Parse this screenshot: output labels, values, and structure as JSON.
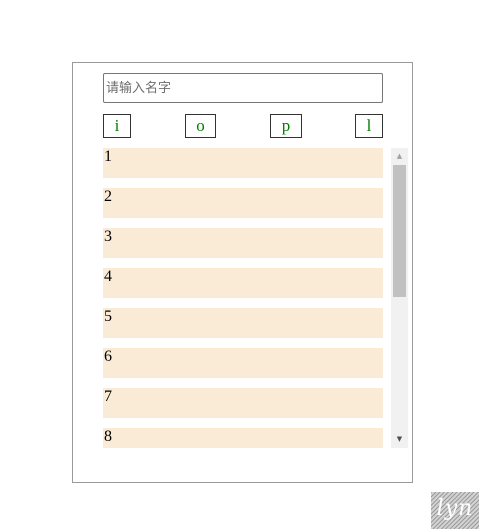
{
  "search": {
    "placeholder": "请输入名字",
    "value": ""
  },
  "letters": [
    "i",
    "o",
    "p",
    "l"
  ],
  "colors": {
    "letter_text": "#008000",
    "item_background": "#faebd7",
    "panel_border": "#9a9a9a"
  },
  "list": {
    "items": [
      "1",
      "2",
      "3",
      "4",
      "5",
      "6",
      "7",
      "8"
    ]
  },
  "scrollbar": {
    "up_icon": "arrow-up-icon",
    "down_icon": "arrow-down-icon",
    "up_glyph": "▲",
    "down_glyph": "▼"
  },
  "watermark": {
    "text": "lyn"
  }
}
